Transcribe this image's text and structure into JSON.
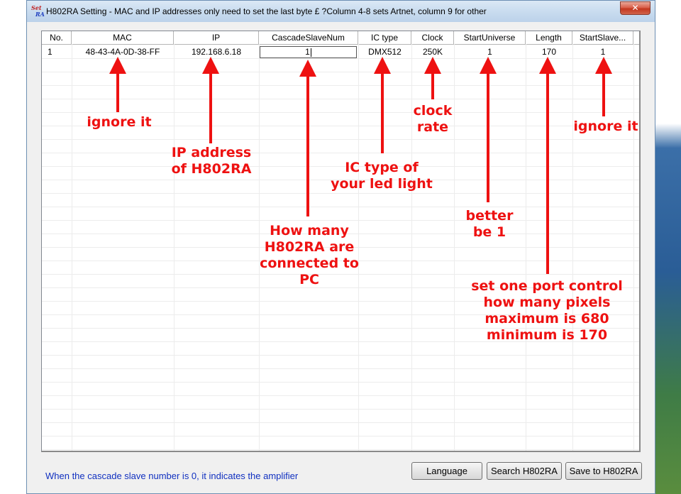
{
  "window": {
    "title": "H802RA Setting - MAC and IP addresses only need to set the last byte £ ?Column 4-8 sets Artnet, column 9 for other",
    "icon_text_top": "Set",
    "icon_text_bottom": "RA",
    "close_label": "✕"
  },
  "table": {
    "columns": [
      "No.",
      "MAC",
      "IP",
      "CascadeSlaveNum",
      "IC type",
      "Clock",
      "StartUniverse",
      "Length",
      "StartSlave..."
    ],
    "rows": [
      {
        "no": "1",
        "mac": "48-43-4A-0D-38-FF",
        "ip": "192.168.6.18",
        "cascade": "1",
        "ic_type": "DMX512",
        "clock": "250K",
        "start_universe": "1",
        "length": "170",
        "start_slave": "1"
      }
    ]
  },
  "annotations": {
    "mac": [
      "ignore it"
    ],
    "ip": [
      "IP address",
      "of H802RA"
    ],
    "cascade": [
      "How many",
      "H802RA are",
      "connected to",
      "PC"
    ],
    "ic_type": [
      "IC type of",
      "your led light"
    ],
    "clock": [
      "clock",
      "rate"
    ],
    "start_universe": [
      "better",
      "be 1"
    ],
    "length": [
      "set one port control",
      "how many pixels",
      "maximum is 680",
      "minimum is 170"
    ],
    "start_slave": [
      "ignore it"
    ],
    "color": "#ee1111"
  },
  "footer": {
    "status": "When the cascade slave number is 0, it indicates the amplifier",
    "buttons": {
      "language": "Language",
      "search": "Search H802RA",
      "save": "Save to H802RA"
    }
  }
}
